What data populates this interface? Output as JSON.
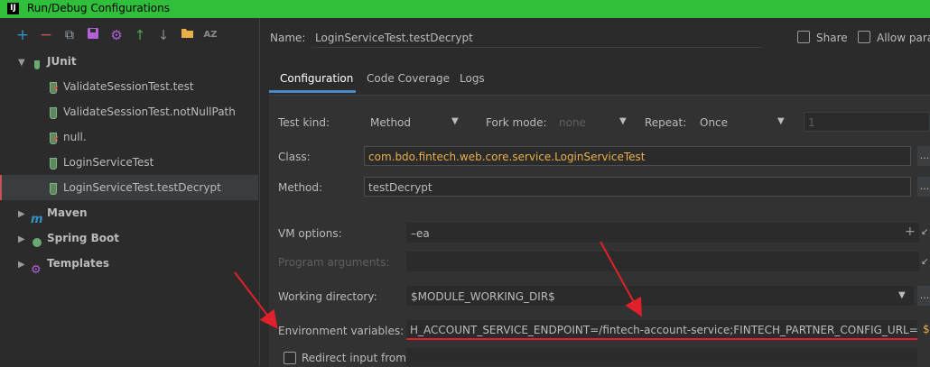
{
  "window": {
    "title": "Run/Debug Configurations",
    "logo_text": "IJ"
  },
  "toolbar": {
    "add": "+",
    "remove": "−",
    "copy": "⧉",
    "save": "💾",
    "settings": "⚙",
    "up": "↑",
    "down": "↓",
    "folder": "📁",
    "sort": "AZ"
  },
  "tree": {
    "junit": "JUnit",
    "items": [
      {
        "label": "ValidateSessionTest.test",
        "status": "failed"
      },
      {
        "label": "ValidateSessionTest.notNullPath",
        "status": "ok"
      },
      {
        "label": "null.",
        "status": "failed"
      },
      {
        "label": "LoginServiceTest",
        "status": "ok"
      },
      {
        "label": "LoginServiceTest.testDecrypt",
        "status": "ok"
      }
    ],
    "maven": "Maven",
    "spring_boot": "Spring Boot",
    "templates": "Templates"
  },
  "header": {
    "name_label": "Name:",
    "name_value": "LoginServiceTest.testDecrypt",
    "share_label": "Share",
    "allow_parallel_label": "Allow paral"
  },
  "tabs": [
    "Configuration",
    "Code Coverage",
    "Logs"
  ],
  "config": {
    "test_kind_label": "Test kind:",
    "test_kind_value": "Method",
    "fork_mode_label": "Fork mode:",
    "fork_mode_value": "none",
    "repeat_label": "Repeat:",
    "repeat_value": "Once",
    "repeat_count": "1",
    "class_label": "Class:",
    "class_value": "com.bdo.fintech.web.core.service.LoginServiceTest",
    "method_label": "Method:",
    "method_value": "testDecrypt",
    "vm_options_label": "VM options:",
    "vm_options_value": "–ea",
    "program_args_label": "Program arguments:",
    "working_dir_label": "Working directory:",
    "working_dir_value": "$MODULE_WORKING_DIR$",
    "env_vars_label": "Environment variables:",
    "env_vars_value": "H_ACCOUNT_SERVICE_ENDPOINT=/fintech-account-service;FINTECH_PARTNER_CONFIG_URL=/ms-api/fi",
    "redirect_label": "Redirect input from:",
    "dots": "..."
  },
  "colors": {
    "titlebar": "#2fbf3a",
    "accent": "#4a88c7",
    "annotation": "#e0202a",
    "class_text": "#e8b04a"
  }
}
